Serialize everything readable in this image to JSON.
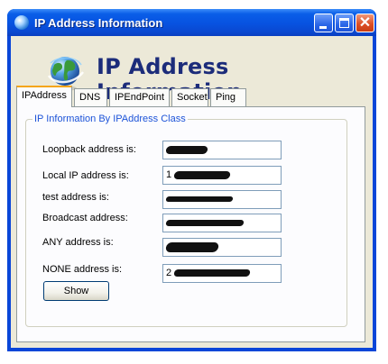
{
  "window": {
    "title": "IP Address Information"
  },
  "header": {
    "title": "IP Address Information"
  },
  "tabs": [
    {
      "label": "IPAddress",
      "active": true
    },
    {
      "label": "DNS",
      "active": false
    },
    {
      "label": "IPEndPoint",
      "active": false
    },
    {
      "label": "Socket",
      "active": false
    },
    {
      "label": "Ping",
      "active": false
    }
  ],
  "group": {
    "title": "IP Information By IPAddress Class",
    "rows": [
      {
        "label": "Loopback address is:",
        "value": ""
      },
      {
        "label": "Local IP address is:",
        "value": "1"
      },
      {
        "label": "test address is:",
        "value": ""
      },
      {
        "label": "Broadcast address:",
        "value": ""
      },
      {
        "label": "ANY address is:",
        "value": ""
      },
      {
        "label": "NONE address is:",
        "value": "2"
      }
    ]
  },
  "buttons": {
    "show": "Show"
  },
  "colors": {
    "title_bar": "#0a5ee8",
    "header_text": "#1c2c7a",
    "group_title": "#1c53d8",
    "active_tab_highlight": "#f5a518",
    "close_button": "#dd4f27"
  },
  "icons": {
    "app": "globe-icon",
    "header": "globe-icon",
    "minimize": "minimize-icon",
    "maximize": "maximize-icon",
    "close": "close-icon"
  }
}
